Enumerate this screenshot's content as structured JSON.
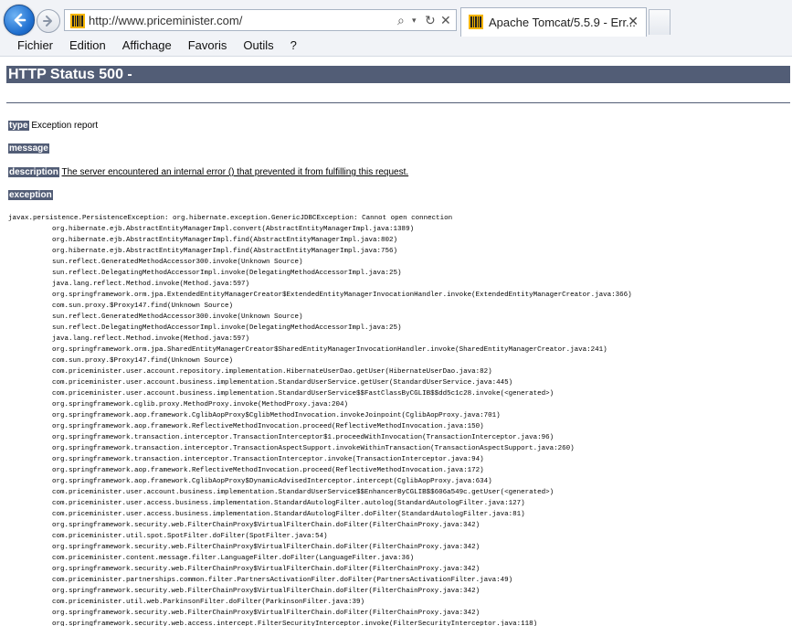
{
  "browser": {
    "url": "http://www.priceminister.com/",
    "tab_title": "Apache Tomcat/5.5.9 - Err...",
    "tab_close": "✕",
    "menu": [
      "Fichier",
      "Edition",
      "Affichage",
      "Favoris",
      "Outils",
      "?"
    ]
  },
  "page": {
    "heading": "HTTP Status 500 -",
    "type_label": "type",
    "type_value": "Exception report",
    "message_label": "message",
    "description_label": "description",
    "description_value": "The server encountered an internal error () that prevented it from fulfilling this request.",
    "exception_label": "exception",
    "trace_head": "javax.persistence.PersistenceException: org.hibernate.exception.GenericJDBCException: Cannot open connection",
    "trace": [
      "org.hibernate.ejb.AbstractEntityManagerImpl.convert(AbstractEntityManagerImpl.java:1389)",
      "org.hibernate.ejb.AbstractEntityManagerImpl.find(AbstractEntityManagerImpl.java:802)",
      "org.hibernate.ejb.AbstractEntityManagerImpl.find(AbstractEntityManagerImpl.java:756)",
      "sun.reflect.GeneratedMethodAccessor300.invoke(Unknown Source)",
      "sun.reflect.DelegatingMethodAccessorImpl.invoke(DelegatingMethodAccessorImpl.java:25)",
      "java.lang.reflect.Method.invoke(Method.java:597)",
      "org.springframework.orm.jpa.ExtendedEntityManagerCreator$ExtendedEntityManagerInvocationHandler.invoke(ExtendedEntityManagerCreator.java:366)",
      "com.sun.proxy.$Proxy147.find(Unknown Source)",
      "sun.reflect.GeneratedMethodAccessor300.invoke(Unknown Source)",
      "sun.reflect.DelegatingMethodAccessorImpl.invoke(DelegatingMethodAccessorImpl.java:25)",
      "java.lang.reflect.Method.invoke(Method.java:597)",
      "org.springframework.orm.jpa.SharedEntityManagerCreator$SharedEntityManagerInvocationHandler.invoke(SharedEntityManagerCreator.java:241)",
      "com.sun.proxy.$Proxy147.find(Unknown Source)",
      "com.priceminister.user.account.repository.implementation.HibernateUserDao.getUser(HibernateUserDao.java:82)",
      "com.priceminister.user.account.business.implementation.StandardUserService.getUser(StandardUserService.java:445)",
      "com.priceminister.user.account.business.implementation.StandardUserService$$FastClassByCGLIB$$dd5c1c28.invoke(<generated>)",
      "org.springframework.cglib.proxy.MethodProxy.invoke(MethodProxy.java:204)",
      "org.springframework.aop.framework.CglibAopProxy$CglibMethodInvocation.invokeJoinpoint(CglibAopProxy.java:701)",
      "org.springframework.aop.framework.ReflectiveMethodInvocation.proceed(ReflectiveMethodInvocation.java:150)",
      "org.springframework.transaction.interceptor.TransactionInterceptor$1.proceedWithInvocation(TransactionInterceptor.java:96)",
      "org.springframework.transaction.interceptor.TransactionAspectSupport.invokeWithinTransaction(TransactionAspectSupport.java:260)",
      "org.springframework.transaction.interceptor.TransactionInterceptor.invoke(TransactionInterceptor.java:94)",
      "org.springframework.aop.framework.ReflectiveMethodInvocation.proceed(ReflectiveMethodInvocation.java:172)",
      "org.springframework.aop.framework.CglibAopProxy$DynamicAdvisedInterceptor.intercept(CglibAopProxy.java:634)",
      "com.priceminister.user.account.business.implementation.StandardUserService$$EnhancerByCGLIB$$606a549c.getUser(<generated>)",
      "com.priceminister.user.access.business.implementation.StandardAutologFilter.autolog(StandardAutologFilter.java:127)",
      "com.priceminister.user.access.business.implementation.StandardAutologFilter.doFilter(StandardAutologFilter.java:81)",
      "org.springframework.security.web.FilterChainProxy$VirtualFilterChain.doFilter(FilterChainProxy.java:342)",
      "com.priceminister.util.spot.SpotFilter.doFilter(SpotFilter.java:54)",
      "org.springframework.security.web.FilterChainProxy$VirtualFilterChain.doFilter(FilterChainProxy.java:342)",
      "com.priceminister.content.message.filter.LanguageFilter.doFilter(LanguageFilter.java:36)",
      "org.springframework.security.web.FilterChainProxy$VirtualFilterChain.doFilter(FilterChainProxy.java:342)",
      "com.priceminister.partnerships.common.filter.PartnersActivationFilter.doFilter(PartnersActivationFilter.java:49)",
      "org.springframework.security.web.FilterChainProxy$VirtualFilterChain.doFilter(FilterChainProxy.java:342)",
      "com.priceminister.util.web.ParkinsonFilter.doFilter(ParkinsonFilter.java:39)",
      "org.springframework.security.web.FilterChainProxy$VirtualFilterChain.doFilter(FilterChainProxy.java:342)",
      "org.springframework.security.web.access.intercept.FilterSecurityInterceptor.invoke(FilterSecurityInterceptor.java:118)"
    ]
  },
  "colors": {
    "tomcat_header": "#525d76",
    "back_button": "#1f6fcf"
  },
  "icons": [
    "back-arrow-icon",
    "forward-arrow-icon",
    "site-favicon",
    "search-icon",
    "dropdown-icon",
    "refresh-icon",
    "stop-icon",
    "close-icon"
  ]
}
